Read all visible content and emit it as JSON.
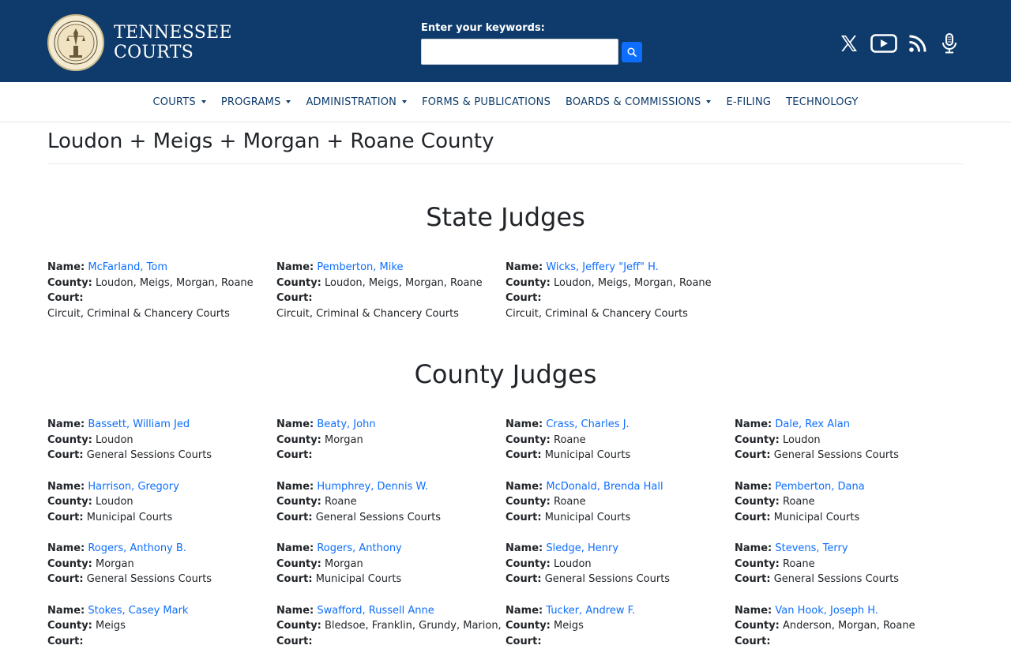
{
  "header": {
    "logo_line1": "TENNESSEE",
    "logo_line2": "COURTS",
    "search_label": "Enter your keywords:",
    "search_value": "",
    "social_icons": [
      "x-icon",
      "youtube-icon",
      "rss-icon",
      "podcast-icon"
    ]
  },
  "nav": [
    {
      "label": "COURTS",
      "dropdown": true
    },
    {
      "label": "PROGRAMS",
      "dropdown": true
    },
    {
      "label": "ADMINISTRATION",
      "dropdown": true
    },
    {
      "label": "FORMS & PUBLICATIONS",
      "dropdown": false
    },
    {
      "label": "BOARDS & COMMISSIONS",
      "dropdown": true
    },
    {
      "label": "E-FILING",
      "dropdown": false
    },
    {
      "label": "TECHNOLOGY",
      "dropdown": false
    }
  ],
  "page_title": "Loudon + Meigs + Morgan + Roane County",
  "labels": {
    "name": "Name:",
    "county": "County:",
    "court": "Court:"
  },
  "state_title": "State Judges",
  "state_judges": [
    {
      "name": "McFarland, Tom",
      "county": "Loudon, Meigs, Morgan, Roane",
      "court": "Circuit, Criminal & Chancery Courts"
    },
    {
      "name": "Pemberton, Mike",
      "county": "Loudon, Meigs, Morgan, Roane",
      "court": "Circuit, Criminal & Chancery Courts"
    },
    {
      "name": "Wicks, Jeffery \"Jeff\" H.",
      "county": "Loudon, Meigs, Morgan, Roane",
      "court": "Circuit, Criminal & Chancery Courts"
    }
  ],
  "county_title": "County Judges",
  "county_judges": [
    {
      "name": "Bassett, William Jed",
      "county": "Loudon",
      "court": "General Sessions Courts"
    },
    {
      "name": "Beaty, John",
      "county": "Morgan",
      "court": ""
    },
    {
      "name": "Crass, Charles J.",
      "county": "Roane",
      "court": "Municipal Courts"
    },
    {
      "name": "Dale, Rex Alan",
      "county": "Loudon",
      "court": "General Sessions Courts"
    },
    {
      "name": "Harrison, Gregory",
      "county": "Loudon",
      "court": "Municipal Courts"
    },
    {
      "name": "Humphrey, Dennis W.",
      "county": "Roane",
      "court": "General Sessions Courts"
    },
    {
      "name": "McDonald, Brenda Hall",
      "county": "Roane",
      "court": "Municipal Courts"
    },
    {
      "name": "Pemberton, Dana",
      "county": "Roane",
      "court": "Municipal Courts"
    },
    {
      "name": "Rogers, Anthony B.",
      "county": "Morgan",
      "court": "General Sessions Courts"
    },
    {
      "name": "Rogers, Anthony",
      "county": "Morgan",
      "court": "Municipal Courts"
    },
    {
      "name": "Sledge, Henry",
      "county": "Loudon",
      "court": "General Sessions Courts"
    },
    {
      "name": "Stevens, Terry",
      "county": "Roane",
      "court": "General Sessions Courts"
    },
    {
      "name": "Stokes, Casey Mark",
      "county": "Meigs",
      "court": ""
    },
    {
      "name": "Swafford, Russell Anne",
      "county": "Bledsoe, Franklin, Grundy, Marion,",
      "court": ""
    },
    {
      "name": "Tucker, Andrew F.",
      "county": "Meigs",
      "court": ""
    },
    {
      "name": "Van Hook, Joseph H.",
      "county": "Anderson, Morgan, Roane",
      "court": ""
    }
  ],
  "colors": {
    "header_bg": "#0e3b6b",
    "link": "#0d6efd",
    "nav_text": "#0e3b6b"
  }
}
